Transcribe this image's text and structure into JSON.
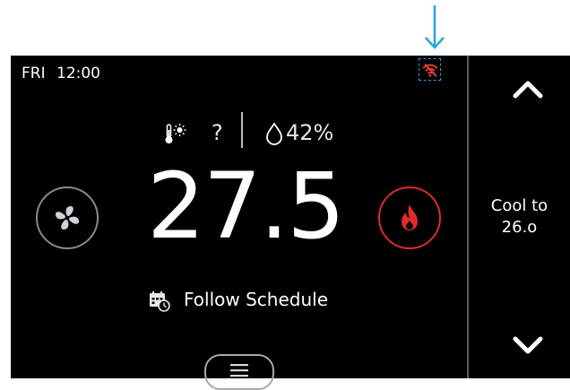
{
  "status": {
    "day": "FRI",
    "time": "12:00"
  },
  "readings": {
    "outdoor_value": "?",
    "humidity": "42%"
  },
  "temperature": "27.5",
  "schedule": {
    "label": "Follow  Schedule"
  },
  "setpoint": {
    "line1": "Cool to",
    "line2": "26.o"
  },
  "colors": {
    "heat": "#e02b2b",
    "wifi_error": "#e53935",
    "annotation": "#22a7e0"
  },
  "icons": {
    "fan": "fan-icon",
    "heat": "flame-icon",
    "wifi": "wifi-off-icon",
    "schedule": "calendar-clock-icon",
    "menu": "menu-icon"
  }
}
